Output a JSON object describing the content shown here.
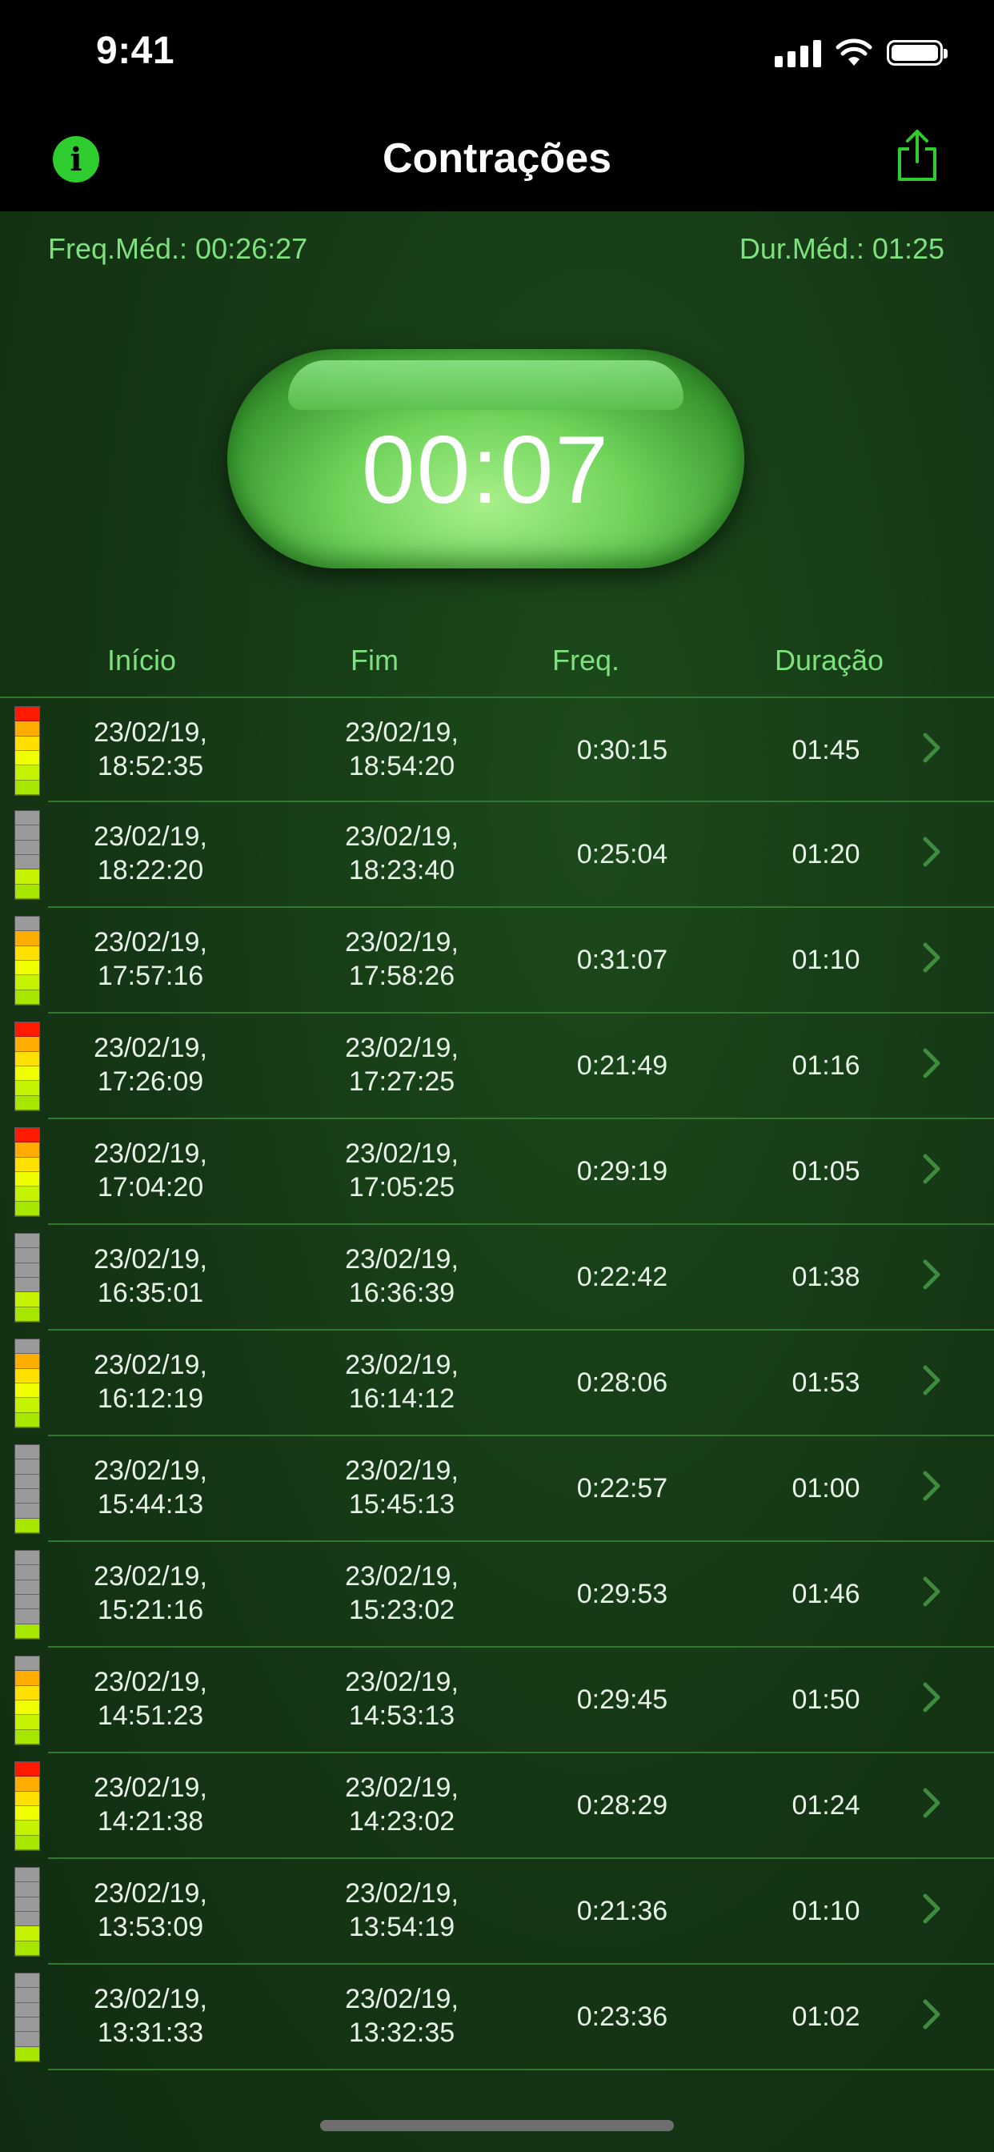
{
  "status_bar": {
    "time": "9:41"
  },
  "nav": {
    "title": "Contrações",
    "info_icon": "info-icon",
    "share_icon": "share-icon"
  },
  "stats": {
    "freq_avg": "Freq.Méd.: 00:26:27",
    "dur_avg": "Dur.Méd.: 01:25"
  },
  "timer": {
    "value": "00:07"
  },
  "table": {
    "headers": {
      "inicio": "Início",
      "fim": "Fim",
      "freq": "Freq.",
      "duracao": "Duração"
    },
    "rows": [
      {
        "inicio_date": "23/02/19,",
        "inicio_time": "18:52:35",
        "fim_date": "23/02/19,",
        "fim_time": "18:54:20",
        "freq": "0:30:15",
        "duracao": "01:45",
        "level": 6
      },
      {
        "inicio_date": "23/02/19,",
        "inicio_time": "18:22:20",
        "fim_date": "23/02/19,",
        "fim_time": "18:23:40",
        "freq": "0:25:04",
        "duracao": "01:20",
        "level": 2
      },
      {
        "inicio_date": "23/02/19,",
        "inicio_time": "17:57:16",
        "fim_date": "23/02/19,",
        "fim_time": "17:58:26",
        "freq": "0:31:07",
        "duracao": "01:10",
        "level": 5
      },
      {
        "inicio_date": "23/02/19,",
        "inicio_time": "17:26:09",
        "fim_date": "23/02/19,",
        "fim_time": "17:27:25",
        "freq": "0:21:49",
        "duracao": "01:16",
        "level": 6
      },
      {
        "inicio_date": "23/02/19,",
        "inicio_time": "17:04:20",
        "fim_date": "23/02/19,",
        "fim_time": "17:05:25",
        "freq": "0:29:19",
        "duracao": "01:05",
        "level": 6
      },
      {
        "inicio_date": "23/02/19,",
        "inicio_time": "16:35:01",
        "fim_date": "23/02/19,",
        "fim_time": "16:36:39",
        "freq": "0:22:42",
        "duracao": "01:38",
        "level": 2
      },
      {
        "inicio_date": "23/02/19,",
        "inicio_time": "16:12:19",
        "fim_date": "23/02/19,",
        "fim_time": "16:14:12",
        "freq": "0:28:06",
        "duracao": "01:53",
        "level": 5
      },
      {
        "inicio_date": "23/02/19,",
        "inicio_time": "15:44:13",
        "fim_date": "23/02/19,",
        "fim_time": "15:45:13",
        "freq": "0:22:57",
        "duracao": "01:00",
        "level": 1
      },
      {
        "inicio_date": "23/02/19,",
        "inicio_time": "15:21:16",
        "fim_date": "23/02/19,",
        "fim_time": "15:23:02",
        "freq": "0:29:53",
        "duracao": "01:46",
        "level": 1
      },
      {
        "inicio_date": "23/02/19,",
        "inicio_time": "14:51:23",
        "fim_date": "23/02/19,",
        "fim_time": "14:53:13",
        "freq": "0:29:45",
        "duracao": "01:50",
        "level": 5
      },
      {
        "inicio_date": "23/02/19,",
        "inicio_time": "14:21:38",
        "fim_date": "23/02/19,",
        "fim_time": "14:23:02",
        "freq": "0:28:29",
        "duracao": "01:24",
        "level": 6
      },
      {
        "inicio_date": "23/02/19,",
        "inicio_time": "13:53:09",
        "fim_date": "23/02/19,",
        "fim_time": "13:54:19",
        "freq": "0:21:36",
        "duracao": "01:10",
        "level": 2
      },
      {
        "inicio_date": "23/02/19,",
        "inicio_time": "13:31:33",
        "fim_date": "23/02/19,",
        "fim_time": "13:32:35",
        "freq": "0:23:36",
        "duracao": "01:02",
        "level": 1
      }
    ]
  },
  "colors": {
    "accent": "#2ecc2e",
    "header_text": "#7ee07e",
    "background": "#163a16",
    "bar_segments": [
      "#ff1a00",
      "#ffae00",
      "#ffe000",
      "#f0ff00",
      "#c4f200",
      "#a6e600"
    ],
    "bar_empty": "#9a9a9a"
  }
}
